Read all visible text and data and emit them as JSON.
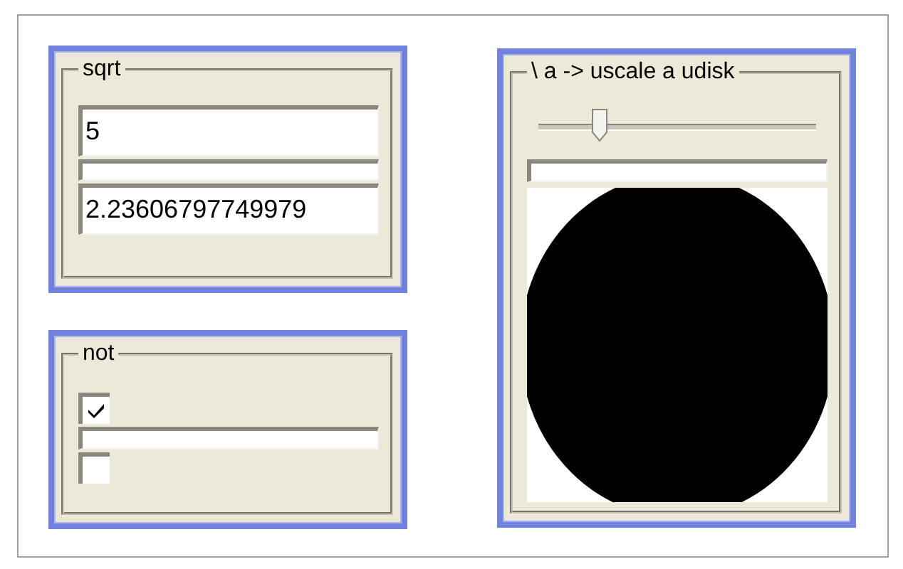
{
  "panels": [
    {
      "kind": "calc",
      "title": "sqrt",
      "input": "5",
      "output": "2.23606797749979"
    },
    {
      "kind": "toggle",
      "title": "not",
      "input_checked": true,
      "output_checked": false
    },
    {
      "kind": "scale",
      "title": "\\ a -> uscale a udisk",
      "slider": {
        "level": 0.22
      }
    }
  ]
}
